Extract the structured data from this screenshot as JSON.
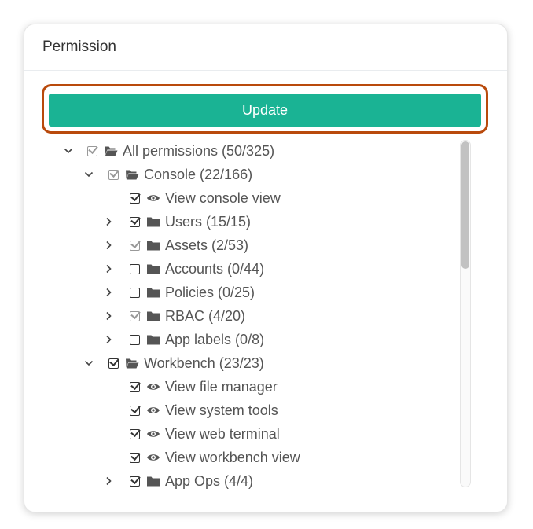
{
  "panel": {
    "title": "Permission"
  },
  "toolbar": {
    "update_label": "Update"
  },
  "colors": {
    "accent": "#1ab394",
    "highlight": "#b94a0c"
  },
  "tree": [
    {
      "label": "All permissions (50/325)",
      "expanded": true,
      "check": "partial",
      "icon": "folder-open-icon"
    },
    {
      "label": "Console (22/166)",
      "expanded": true,
      "check": "partial",
      "icon": "folder-open-icon"
    },
    {
      "label": "View console view",
      "check": "checked",
      "icon": "eye-icon"
    },
    {
      "label": "Users (15/15)",
      "expanded": false,
      "check": "checked",
      "icon": "folder-icon"
    },
    {
      "label": "Assets (2/53)",
      "expanded": false,
      "check": "partial",
      "icon": "folder-icon"
    },
    {
      "label": "Accounts (0/44)",
      "expanded": false,
      "check": "unchecked",
      "icon": "folder-icon"
    },
    {
      "label": "Policies (0/25)",
      "expanded": false,
      "check": "unchecked",
      "icon": "folder-icon"
    },
    {
      "label": "RBAC (4/20)",
      "expanded": false,
      "check": "partial",
      "icon": "folder-icon"
    },
    {
      "label": "App labels (0/8)",
      "expanded": false,
      "check": "unchecked",
      "icon": "folder-icon"
    },
    {
      "label": "Workbench (23/23)",
      "expanded": true,
      "check": "checked",
      "icon": "folder-open-icon"
    },
    {
      "label": "View file manager",
      "check": "checked",
      "icon": "eye-icon"
    },
    {
      "label": "View system tools",
      "check": "checked",
      "icon": "eye-icon"
    },
    {
      "label": "View web terminal",
      "check": "checked",
      "icon": "eye-icon"
    },
    {
      "label": "View workbench view",
      "check": "checked",
      "icon": "eye-icon"
    },
    {
      "label": "App Ops (4/4)",
      "expanded": false,
      "check": "checked",
      "icon": "folder-icon"
    }
  ]
}
